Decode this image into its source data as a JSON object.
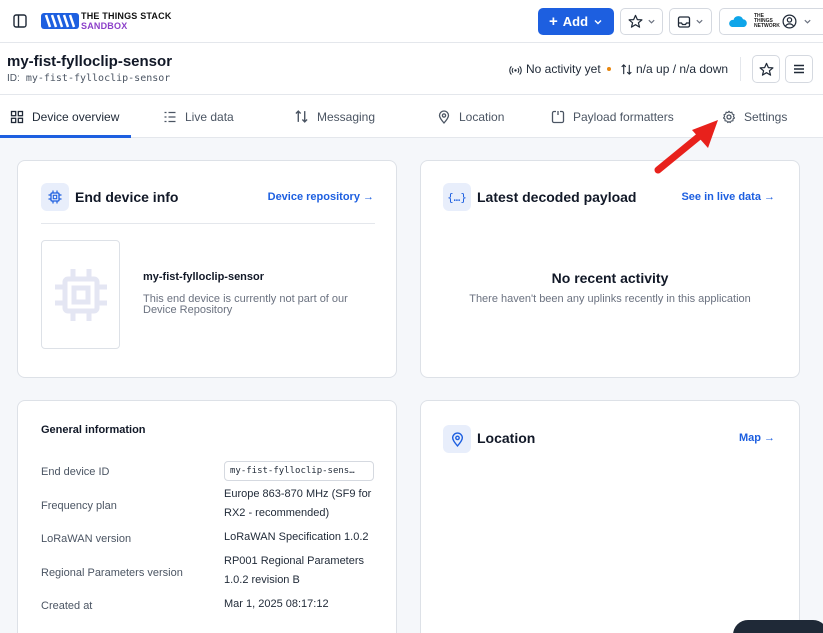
{
  "brand": {
    "line1": "THE THINGS STACK",
    "line2": "SANDBOX",
    "purple": "#8b3fc9"
  },
  "toolbar": {
    "add_label": "Add",
    "ttn_label": "THE THINGS NETWORK",
    "accent": "#1d5fe0"
  },
  "device": {
    "title": "my-fist-fylloclip-sensor",
    "id_label": "ID:",
    "id_value": "my-fist-fylloclip-sensor",
    "activity": "No activity yet",
    "activity_dot_color": "#e8870f",
    "traffic": "n/a up / n/a down"
  },
  "tabs": [
    {
      "label": "Device overview",
      "icon": "grid-icon",
      "active": true
    },
    {
      "label": "Live data",
      "icon": "list-icon",
      "active": false
    },
    {
      "label": "Messaging",
      "icon": "arrows-updown-icon",
      "active": false
    },
    {
      "label": "Location",
      "icon": "map-pin-icon",
      "active": false
    },
    {
      "label": "Payload formatters",
      "icon": "formatter-icon",
      "active": false
    },
    {
      "label": "Settings",
      "icon": "gear-icon",
      "active": false
    }
  ],
  "end_device_info": {
    "title": "End device info",
    "link": "Device repository →",
    "device_name": "my-fist-fylloclip-sensor",
    "description": "This end device is currently not part of our Device Repository"
  },
  "latest_payload": {
    "title": "Latest decoded payload",
    "link": "See in live data →",
    "empty_title": "No recent activity",
    "empty_desc": "There haven't been any uplinks recently in this application"
  },
  "general_info": {
    "title": "General information",
    "rows": [
      {
        "label": "End device ID",
        "value": "my-fist-fylloclip-sens…"
      },
      {
        "label": "Frequency plan",
        "value": "Europe 863-870 MHz (SF9 for RX2 - recommended)"
      },
      {
        "label": "LoRaWAN version",
        "value": "LoRaWAN Specification 1.0.2"
      },
      {
        "label": "Regional Parameters version",
        "value": "RP001 Regional Parameters 1.0.2 revision B"
      },
      {
        "label": "Created at",
        "value": "Mar 1, 2025 08:17:12"
      }
    ]
  },
  "location": {
    "title": "Location",
    "link": "Map →"
  },
  "annotation_color": "#e8211c"
}
